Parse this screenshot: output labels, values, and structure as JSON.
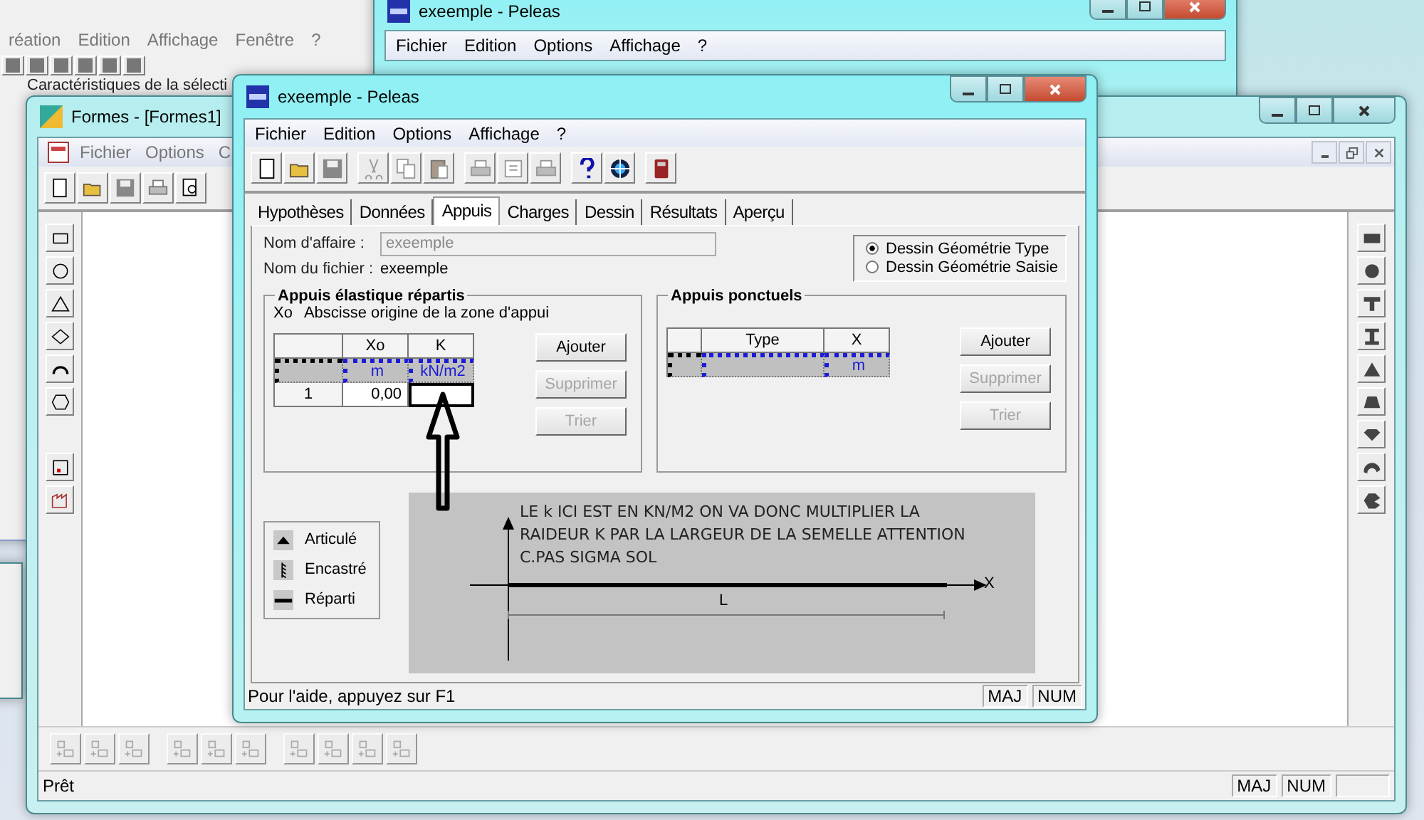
{
  "editor_window": {
    "menu": [
      "réation",
      "Edition",
      "Affichage",
      "Fenêtre",
      "?"
    ],
    "panel_title": "Caractéristiques de la sélecti"
  },
  "background_peleas": {
    "title": "exeemple - Peleas",
    "menu": [
      "Fichier",
      "Edition",
      "Options",
      "Affichage",
      "?"
    ]
  },
  "formes_window": {
    "title": "Formes - [Formes1]",
    "menu": [
      "Fichier",
      "Options",
      "C"
    ],
    "status": "Prêt",
    "indicators": [
      "MAJ",
      "NUM"
    ]
  },
  "dialog": {
    "title": "exeemple - Peleas",
    "menu": [
      "Fichier",
      "Edition",
      "Options",
      "Affichage",
      "?"
    ],
    "tabs": [
      {
        "label": "Hypothèses",
        "selected": false
      },
      {
        "label": "Données",
        "selected": false
      },
      {
        "label": "Appuis",
        "selected": true
      },
      {
        "label": "Charges",
        "selected": false
      },
      {
        "label": "Dessin",
        "selected": false
      },
      {
        "label": "Résultats",
        "selected": false
      },
      {
        "label": "Aperçu",
        "selected": false
      }
    ],
    "fields": [
      {
        "label": "Nom d'affaire :",
        "value": "exeemple",
        "kind": "input",
        "disabled": true
      },
      {
        "label": "Nom du fichier :",
        "value": "exeemple",
        "kind": "text"
      }
    ],
    "drawing_mode": [
      {
        "label": "Dessin Géométrie Type",
        "selected": true
      },
      {
        "label": "Dessin Géométrie Saisie",
        "selected": false
      }
    ],
    "elastic_supports": {
      "title": "Appuis élastique répartis",
      "note_symbol": "Xo",
      "note": "Abscisse origine de la zone d'appui",
      "columns": [
        {
          "label": "Xo",
          "unit": "m"
        },
        {
          "label": "K",
          "unit": "kN/m2"
        }
      ],
      "rows": [
        {
          "index": "1",
          "cells": [
            "0,00"
          ]
        }
      ],
      "buttons": [
        {
          "label": "Ajouter",
          "disabled": false
        },
        {
          "label": "Supprimer",
          "disabled": true
        },
        {
          "label": "Trier",
          "disabled": true
        }
      ]
    },
    "point_supports": {
      "title": "Appuis ponctuels",
      "columns": [
        {
          "label": "Type"
        },
        {
          "label": "X",
          "unit": "m"
        }
      ],
      "buttons": [
        {
          "label": "Ajouter",
          "disabled": false
        },
        {
          "label": "Supprimer",
          "disabled": true
        },
        {
          "label": "Trier",
          "disabled": true
        }
      ]
    },
    "legend": [
      {
        "label": "Articulé",
        "kind": "pin"
      },
      {
        "label": "Encastré",
        "kind": "fixed"
      },
      {
        "label": "Réparti",
        "kind": "distributed"
      }
    ],
    "diagram": {
      "x_axis": "X",
      "length": "L"
    },
    "annotation": "LE k ICI EST EN KN/M2 ON VA DONC MULTIPLIER LA RAIDEUR K PAR LA LARGEUR DE LA SEMELLE ATTENTION C.PAS SIGMA SOL",
    "status": "Pour l'aide, appuyez sur F1",
    "indicators": [
      "MAJ",
      "NUM"
    ]
  }
}
